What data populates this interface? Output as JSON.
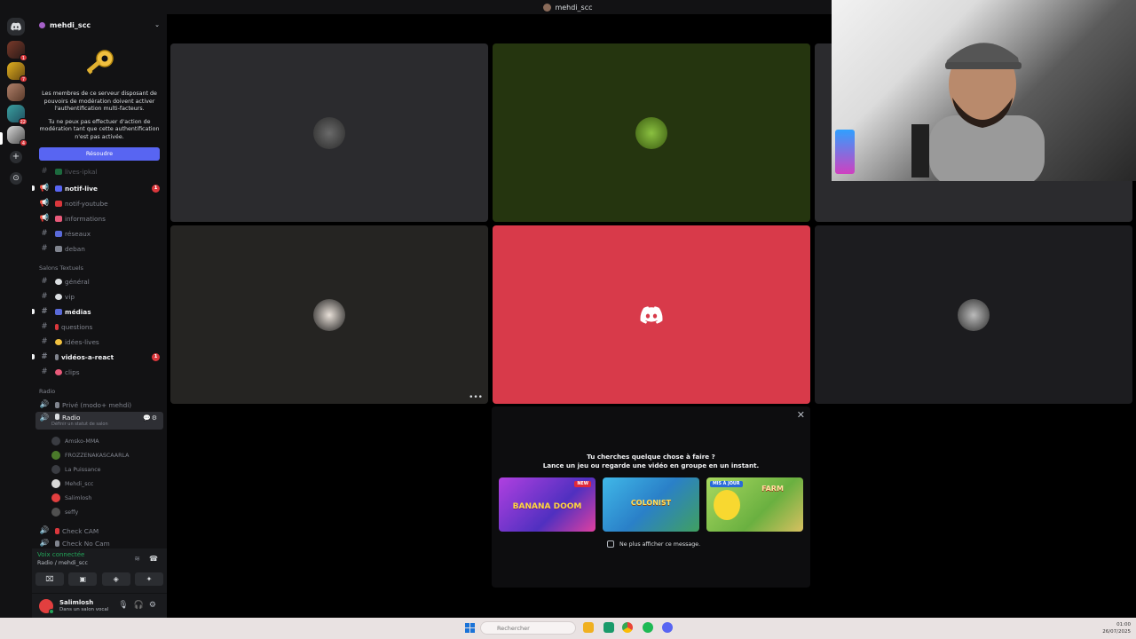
{
  "window": {
    "title": "mehdi_scc"
  },
  "server": {
    "name": "mehdi_scc",
    "mfa_text_1": "Les membres de ce serveur disposant de pouvoirs de modération doivent activer l'authentification multi-facteurs.",
    "mfa_text_2": "Tu ne peux pas effectuer d'action de modération tant que cette authentification n'est pas activée.",
    "resolve_label": "Résoudre"
  },
  "rail": {
    "badges": [
      "1",
      "7",
      "",
      "22",
      "4"
    ],
    "add_label": "+",
    "explore_label": "⊙"
  },
  "channels": {
    "partial_top": "lives-ipkal",
    "items_top": [
      {
        "name": "notif-live",
        "unread": true,
        "badge": "1"
      },
      {
        "name": "notif-youtube"
      },
      {
        "name": "informations"
      },
      {
        "name": "réseaux"
      },
      {
        "name": "deban"
      }
    ],
    "category_text": "Salons Textuels",
    "items_text": [
      {
        "name": "général"
      },
      {
        "name": "vip"
      },
      {
        "name": "médias",
        "unread": true
      },
      {
        "name": "questions"
      },
      {
        "name": "idées-lives"
      },
      {
        "name": "vidéos-a-react",
        "unread": true,
        "badge": "1"
      },
      {
        "name": "clips"
      }
    ],
    "category_radio": "Radio",
    "voice_private": "Privé (modo+ mehdi)",
    "voice_active": "Radio",
    "voice_active_sub": "Définir un statut de salon",
    "members": [
      "Amsko-MMA",
      "FROZZENAKASCAARLA",
      "La Puissance",
      "Mehdi_scc",
      "Salimlosh",
      "seffy"
    ],
    "check_cam": "Check CAM",
    "check_no_cam": "Check No Cam"
  },
  "voice_panel": {
    "status": "Voix connectée",
    "room": "Radio / mehdi_scc"
  },
  "user": {
    "name": "Salimlosh",
    "status": "Dans un salon vocal"
  },
  "activity": {
    "heading": "Tu cherches quelque chose à faire ?",
    "subheading": "Lance un jeu ou regarde une vidéo en groupe en un instant.",
    "games": [
      {
        "name": "BANANA DOOM",
        "tag": "NEW"
      },
      {
        "name": "COLONIST",
        "tag": ""
      },
      {
        "name": "FARM",
        "tag": "MIS À JOUR"
      }
    ],
    "dont_show": "Ne plus afficher ce message."
  },
  "taskbar": {
    "search_placeholder": "Rechercher",
    "time": "01:00",
    "date": "26/07/2025"
  },
  "colors": {
    "accent": "#5865f2",
    "danger": "#da373c",
    "online": "#23a55a",
    "tile_red": "#d83a4a",
    "tile_green": "#25350f"
  }
}
